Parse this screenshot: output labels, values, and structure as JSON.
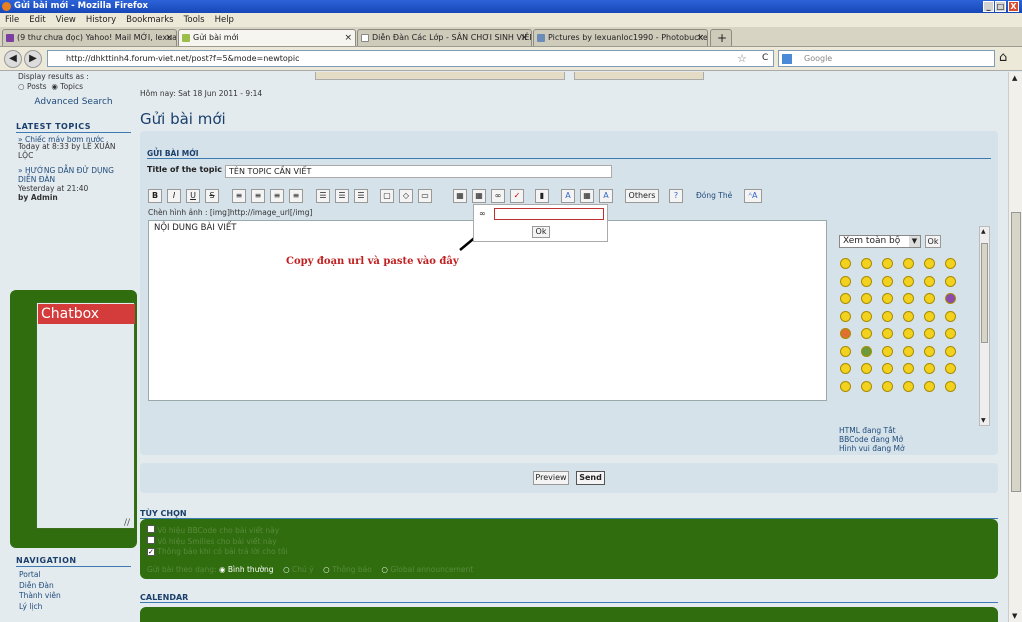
{
  "window": {
    "title": "Gửi bài mới - Mozilla Firefox",
    "min": "_",
    "max": "□",
    "close": "X"
  },
  "menu": [
    "File",
    "Edit",
    "View",
    "History",
    "Bookmarks",
    "Tools",
    "Help"
  ],
  "tabs": [
    {
      "label": "(9 thư chưa đọc) Yahoo! Mail MỚI, lexua...",
      "close": "×"
    },
    {
      "label": "Gửi bài mới",
      "close": "×"
    },
    {
      "label": "Diễn Đàn Các Lớp - SÂN CHƠI SINH VIÊN...",
      "close": "×"
    },
    {
      "label": "Pictures by lexuanloc1990 - Photobucket",
      "close": "×"
    },
    {
      "label": "+"
    }
  ],
  "nav": {
    "back": "◀",
    "forward": "▶",
    "url": "http://dhkttinh4.forum-viet.net/post?f=5&mode=newtopic",
    "search_placeholder": "Google",
    "home": "⌂",
    "star": "☆",
    "reload": "C"
  },
  "sidebar": {
    "display_text": "Display results as :",
    "radio_posts": "Posts",
    "radio_topics": "Topics",
    "advanced_search": "Advanced Search",
    "latest_title": "LATEST TOPICS",
    "latest": [
      {
        "title": "» Chiếc máy bơm nước",
        "meta": "Today at 8:33 by LÊ XUÂN LỘC"
      },
      {
        "title": "» HƯỚNG DẪN ĐỬ DỤNG DIỄN ĐÀN",
        "meta": "Yesterday at 21:40",
        "by": "by Admin"
      }
    ],
    "chatbox": "Chatbox",
    "nav_title": "NAVIGATION",
    "nav_links": [
      "Portal",
      "Diễn Đàn",
      "Thành viên",
      "Lý lịch"
    ]
  },
  "main": {
    "date": "Hôm nay: Sat 18 Jun 2011 - 9:14",
    "page_title": "Gửi bài mới",
    "section": "GỬI BÀI MỚI",
    "title_label": "Title of the topic",
    "title_value": "TÊN TOPIC CẦN VIẾT",
    "toolbar": [
      "B",
      "I",
      "U",
      "S",
      "≡",
      "≡",
      "≡",
      "≡",
      "☰",
      "☰",
      "☰",
      "▢",
      "◇",
      "▭",
      "▦",
      "▦",
      "∞",
      "✓",
      "▮",
      "A",
      "▦",
      "A"
    ],
    "others_button": "Others",
    "dong_the": "Đóng Thẻ",
    "image_hint": "Chèn hình ảnh : [img]http://image_url[/img]",
    "editor_text": "NỘI DUNG BÀI VIẾT",
    "annotation": "Copy đoạn url và paste vào đây",
    "popup_ok": "Ok",
    "smilies_select": "Xem toàn bộ",
    "smilies_ok": "Ok",
    "status": [
      "HTML đang Tắt",
      "BBCode đang Mở",
      "Hình vui đang Mở"
    ],
    "preview": "Preview",
    "send": "Send",
    "options_title": "TÙY CHỌN",
    "options": [
      "Vô hiệu BBCode cho bài viết này",
      "Vô hiệu Smilies cho bài viết này",
      "Thông báo khi có bài trả lời cho tôi"
    ],
    "post_type_label": "Gửi bài theo dạng:",
    "post_types": [
      "Bình thường",
      "Chú ý",
      "Thông báo",
      "Global announcement"
    ],
    "calendar": "CALENDAR"
  }
}
